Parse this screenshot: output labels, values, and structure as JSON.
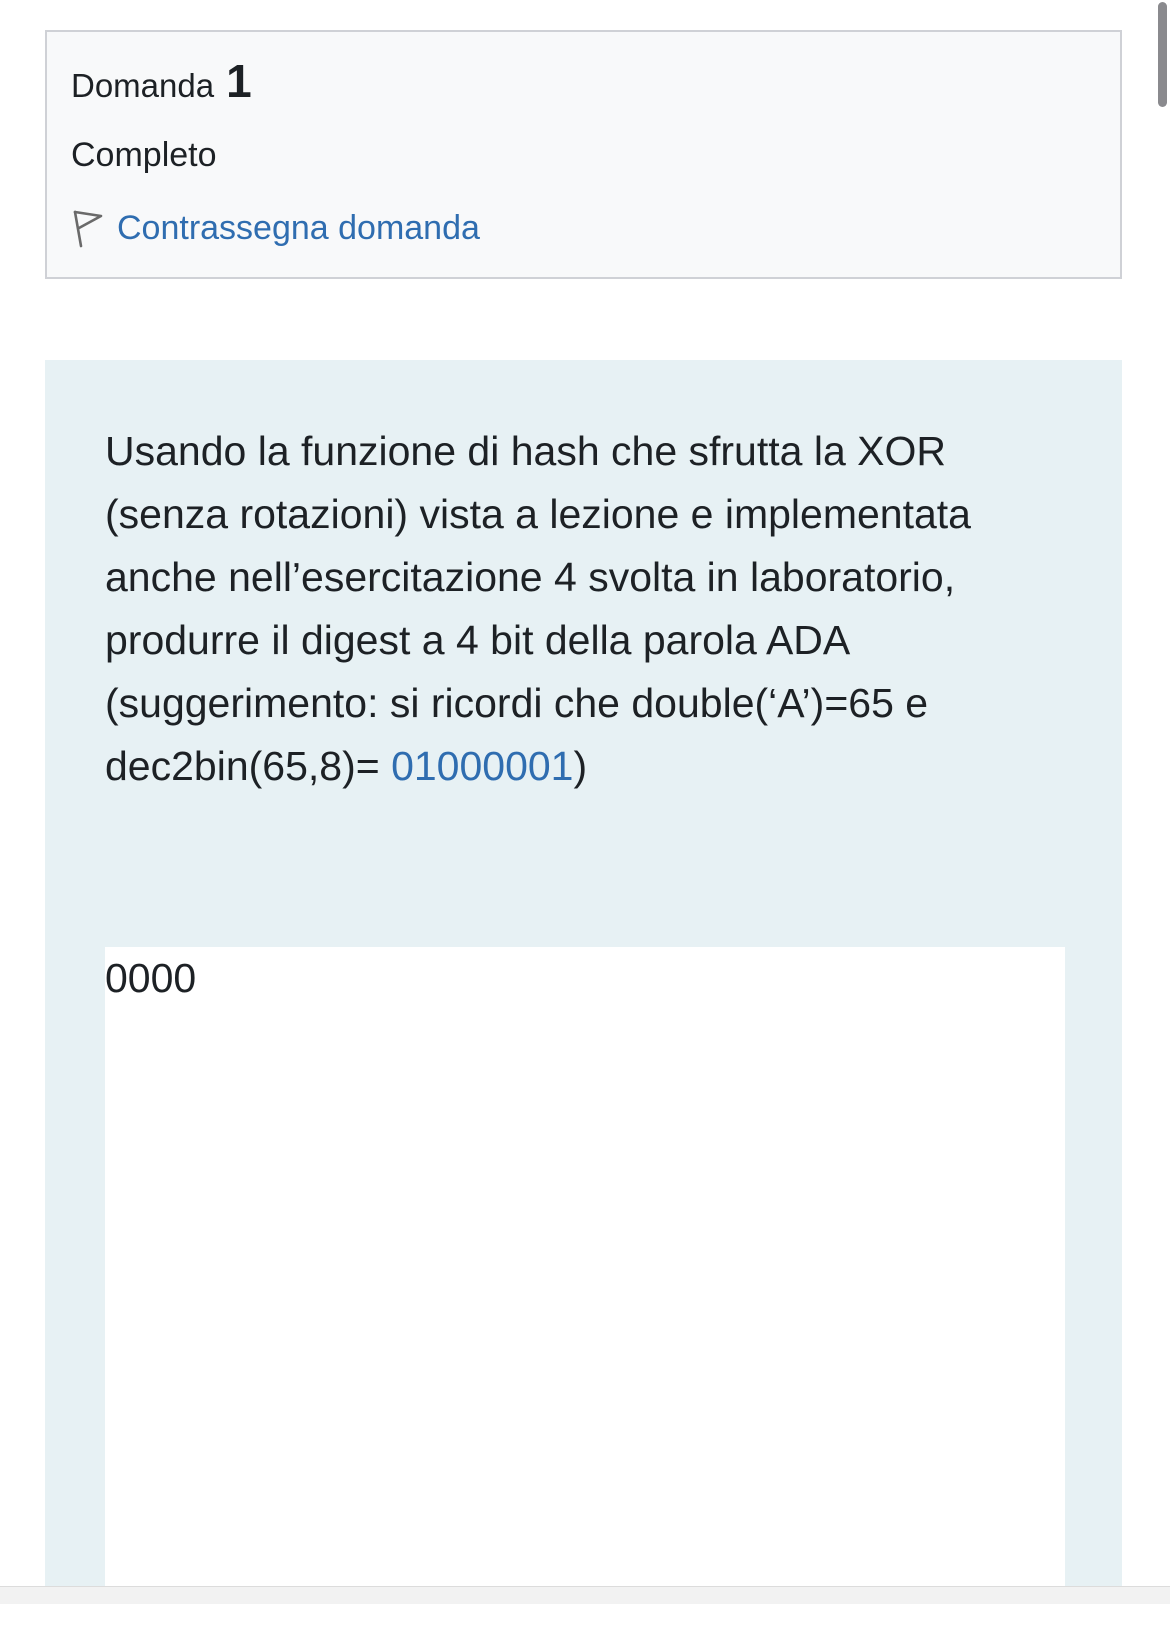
{
  "question_info": {
    "label": "Domanda",
    "number": "1",
    "state": "Completo",
    "flag_label": "Contrassegna domanda"
  },
  "question_text": {
    "line1": "Usando la funzione di hash che sfrutta la XOR",
    "line2": "(senza rotazioni) vista a lezione e implementata",
    "line3": "anche nell’esercitazione 4 svolta in laboratorio,",
    "line4": "produrre il digest a 4 bit della parola ADA",
    "line5": "(suggerimento: si ricordi che double(‘A’)=65 e",
    "line6_prefix": "dec2bin(65,8)= ",
    "line6_highlight": "01000001",
    "line6_suffix": ")"
  },
  "answer": {
    "value": "0000"
  },
  "icons": {
    "flag": "flag-outline-icon"
  },
  "colors": {
    "link": "#2f6db0",
    "info_bg": "#f8f9fa",
    "formulation_bg": "#e7f1f4"
  }
}
